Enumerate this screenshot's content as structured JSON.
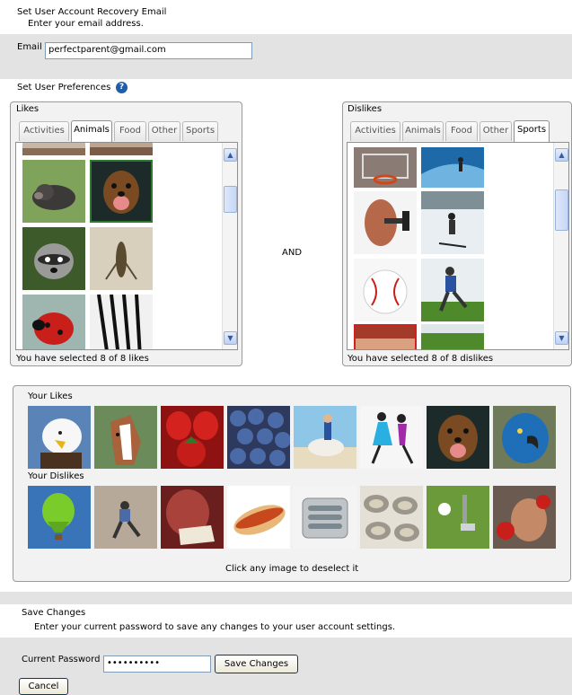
{
  "recovery": {
    "heading": "Set User Account Recovery Email",
    "subheading": "Enter your email address.",
    "email_label": "Email",
    "email_value": "perfectparent@gmail.com"
  },
  "preferences": {
    "heading": "Set User Preferences",
    "help_glyph": "?",
    "and_label": "AND",
    "likes": {
      "legend": "Likes",
      "tabs": [
        "Activities",
        "Animals",
        "Food",
        "Other",
        "Sports"
      ],
      "active_tab": "Animals",
      "status": "You have selected 8 of 8 likes",
      "images": [
        "pig",
        "dog",
        "raccoon",
        "grasshopper",
        "ladybug",
        "zebra"
      ]
    },
    "dislikes": {
      "legend": "Dislikes",
      "tabs": [
        "Activities",
        "Animals",
        "Food",
        "Other",
        "Sports"
      ],
      "active_tab": "Sports",
      "status": "You have selected 8 of 8 dislikes",
      "images": [
        "basketball-hoop",
        "surfer",
        "dumbbell",
        "skier",
        "baseball",
        "soccer-player",
        "boxing",
        "grass-field"
      ]
    },
    "your_likes_label": "Your Likes",
    "your_likes": [
      "eagle",
      "horse",
      "strawberries",
      "blueberries",
      "horse-rider",
      "dancers",
      "dog",
      "parrot"
    ],
    "your_dislikes_label": "Your Dislikes",
    "your_dislikes": [
      "hot-air-balloon",
      "rock-climber",
      "reading",
      "hot-dog",
      "sardines",
      "oysters",
      "golf",
      "boxer"
    ],
    "deselect_hint": "Click any image to deselect it"
  },
  "save": {
    "heading": "Save Changes",
    "subheading": "Enter your current password to save any changes to your user account settings.",
    "password_label": "Current Password",
    "password_value": "••••••••••",
    "save_button": "Save Changes",
    "cancel_button": "Cancel"
  },
  "colors": {
    "band": "#e3e3e3",
    "selected_border": "#2d7a2d",
    "help_icon": "#1f5fa8"
  }
}
